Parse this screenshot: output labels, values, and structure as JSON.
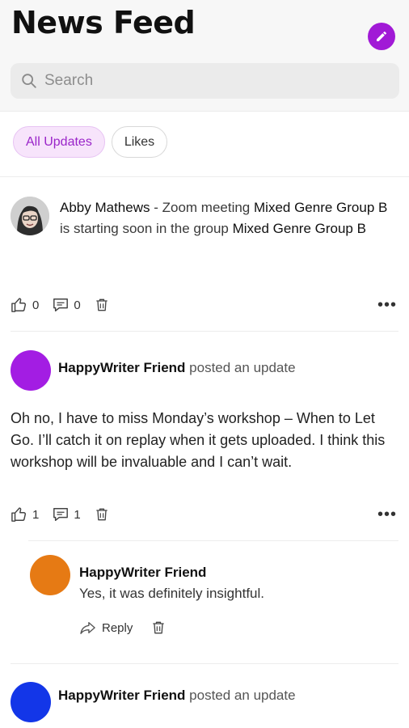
{
  "header": {
    "title": "News Feed",
    "compose_icon": "pencil-icon",
    "accent": "#a11ad6"
  },
  "search": {
    "placeholder": "Search"
  },
  "tabs": [
    {
      "label": "All Updates",
      "active": true
    },
    {
      "label": "Likes",
      "active": false
    }
  ],
  "activity": {
    "author": "Abby Mathews",
    "text_1": " - Zoom meeting ",
    "meeting": "Mixed Genre Group B",
    "text_2": " is starting soon in the group ",
    "group": "Mixed Genre Group B",
    "likes": "0",
    "comments": "0"
  },
  "post": {
    "author": "HappyWriter Friend",
    "verb": "posted an update",
    "avatar_color": "#a31de3",
    "body": "Oh no, I have to miss Monday’s workshop – When to Let Go. I’ll catch it on replay when it gets uploaded. I think this workshop will be invaluable and I can’t wait.",
    "likes": "1",
    "comments": "1"
  },
  "reply": {
    "author": "HappyWriter Friend",
    "text": "Yes, it was definitely insightful.",
    "avatar_color": "#e67a14",
    "action_label": "Reply"
  },
  "post2": {
    "author": "HappyWriter Friend",
    "verb": "posted an update",
    "avatar_color": "#1336e8"
  }
}
